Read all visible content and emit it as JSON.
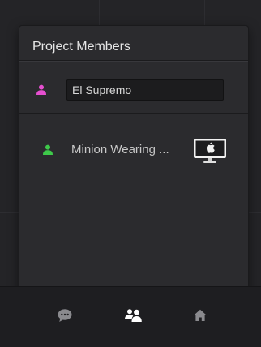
{
  "popover": {
    "title": "Project Members"
  },
  "members": [
    {
      "name": "El Supremo",
      "color": "#e64fd0",
      "editable": true
    },
    {
      "name": "Minion Wearing ...",
      "color": "#3ec94a",
      "platform_icon": "mac-computer-icon"
    }
  ],
  "bottom_bar": {
    "tabs": [
      {
        "icon": "chat-bubble-icon",
        "active": false
      },
      {
        "icon": "people-icon",
        "active": true
      },
      {
        "icon": "home-icon",
        "active": false
      }
    ]
  },
  "colors": {
    "popover_bg": "#2b2b2e",
    "text": "#e6e6e6",
    "inactive_icon": "#8a8a8e",
    "active_icon": "#ffffff"
  }
}
